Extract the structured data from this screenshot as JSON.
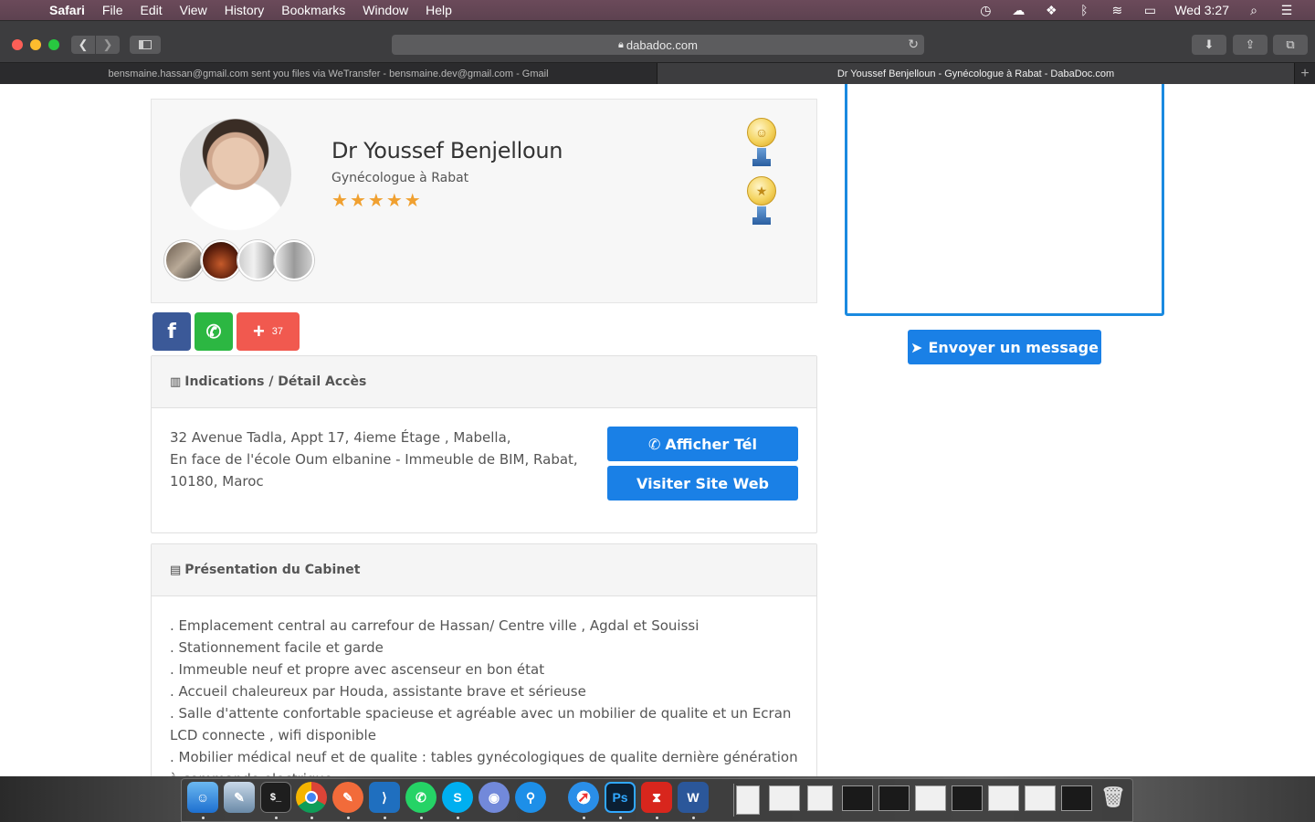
{
  "menubar": {
    "app": "Safari",
    "items": [
      "File",
      "Edit",
      "View",
      "History",
      "Bookmarks",
      "Window",
      "Help"
    ],
    "clock": "Wed 3:27"
  },
  "browser": {
    "url": "dabadoc.com",
    "tabs": [
      {
        "title": "bensmaine.hassan@gmail.com sent you files via WeTransfer - bensmaine.dev@gmail.com - Gmail"
      },
      {
        "title": "Dr Youssef Benjelloun - Gynécologue à Rabat - DabaDoc.com"
      }
    ],
    "new_tab": "+"
  },
  "profile": {
    "name": "Dr Youssef Benjelloun",
    "specialty": "Gynécologue à Rabat",
    "rating": 5
  },
  "share": {
    "plus_count": "37"
  },
  "access": {
    "title": "Indications / Détail Accès",
    "address_line1": "32 Avenue Tadla, Appt 17, 4ieme Étage , Mabella,",
    "address_line2": "En face de l'école Oum elbanine - Immeuble de BIM, Rabat,",
    "address_line3": "10180, Maroc",
    "tel_button": "Afficher Tél",
    "site_button": "Visiter Site Web"
  },
  "cabinet": {
    "title": "Présentation du Cabinet",
    "items": [
      ". Emplacement central au carrefour de Hassan/ Centre ville , Agdal et Souissi",
      ". Stationnement facile et garde",
      ". Immeuble neuf et propre avec ascenseur en bon état",
      ". Accueil chaleureux par Houda, assistante brave et sérieuse",
      ". Salle d'attente confortable spacieuse et agréable avec un mobilier de qualite et un Ecran LCD connecte , wifi disponible",
      ". Mobilier médical neuf et de qualite : tables gynécologiques de qualite dernière génération à commande electrique"
    ]
  },
  "message": {
    "send_button": "Envoyer un message"
  },
  "dock": {
    "apps": [
      "finder-icon",
      "preview-icon",
      "terminal-icon",
      "chrome-icon",
      "pencil-app-icon",
      "vscode-icon",
      "whatsapp-icon",
      "skype-icon",
      "discord-icon",
      "maps-pin-icon",
      "safari-icon",
      "photoshop-icon",
      "acrobat-icon",
      "word-icon"
    ],
    "labels": {
      "photoshop": "Ps",
      "word": "W",
      "skype": "S"
    }
  }
}
